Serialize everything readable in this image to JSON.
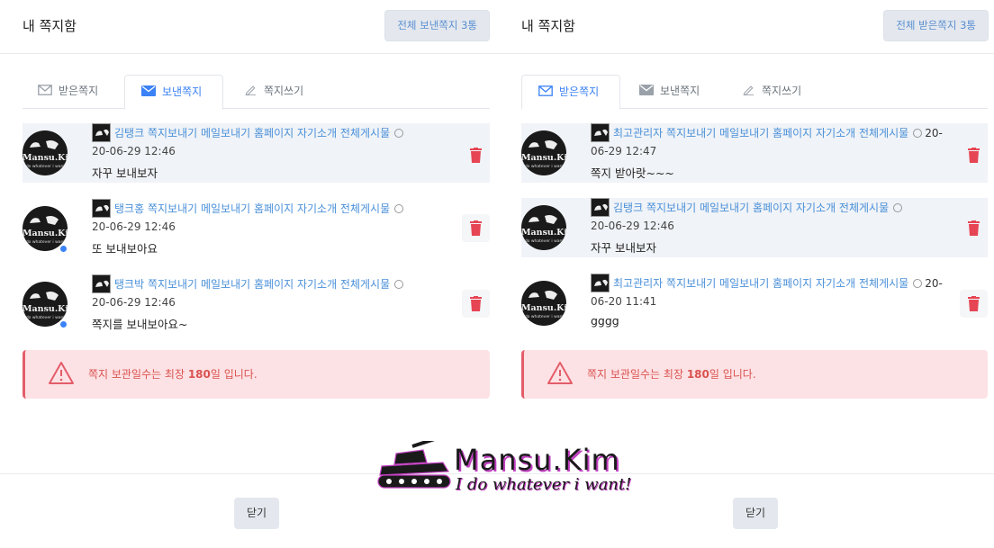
{
  "left": {
    "title": "내 쪽지함",
    "count_button": "전체 보낸쪽지 3통",
    "tabs": [
      {
        "label": "받은쪽지",
        "active": false,
        "icon": "envelope-outline-icon"
      },
      {
        "label": "보낸쪽지",
        "active": true,
        "icon": "envelope-filled-icon"
      },
      {
        "label": "쪽지쓰기",
        "active": false,
        "icon": "pencil-icon"
      }
    ],
    "messages": [
      {
        "name": "김탱크",
        "links": "쪽지보내기 메일보내기 홈페이지 자기소개 전체게시물",
        "date": "20-06-29 12:46",
        "text": "자꾸 보내보자",
        "highlighted": true,
        "unread": false
      },
      {
        "name": "탱크홍",
        "links": "쪽지보내기 메일보내기 홈페이지 자기소개 전체게시물",
        "date": "20-06-29 12:46",
        "text": "또 보내보아요",
        "highlighted": false,
        "unread": true
      },
      {
        "name": "탱크박",
        "links": "쪽지보내기 메일보내기 홈페이지 자기소개 전체게시물",
        "date": "20-06-29 12:46",
        "text": "쪽지를 보내보아요~",
        "highlighted": false,
        "unread": true
      }
    ],
    "alert": {
      "prefix": "쪽지 보관일수는 최장 ",
      "days": "180",
      "suffix": "일 입니다."
    },
    "close_label": "닫기"
  },
  "right": {
    "title": "내 쪽지함",
    "count_button": "전체 받은쪽지 3통",
    "tabs": [
      {
        "label": "받은쪽지",
        "active": true,
        "icon": "envelope-outline-icon"
      },
      {
        "label": "보낸쪽지",
        "active": false,
        "icon": "envelope-filled-icon"
      },
      {
        "label": "쪽지쓰기",
        "active": false,
        "icon": "pencil-icon"
      }
    ],
    "messages": [
      {
        "name": "최고관리자",
        "links": "쪽지보내기 메일보내기 홈페이지 자기소개 전체게시물",
        "date_a": "20-",
        "date_b": "06-29 12:47",
        "text": "쪽지 받아랏~~~",
        "highlighted": true,
        "unread": false
      },
      {
        "name": "김탱크",
        "links": "쪽지보내기 메일보내기 홈페이지 자기소개 전체게시물",
        "date": "20-06-29 12:46",
        "text": "자꾸 보내보자",
        "highlighted": true,
        "unread": false
      },
      {
        "name": "최고관리자",
        "links": "쪽지보내기 메일보내기 홈페이지 자기소개 전체게시물",
        "date_a": "20-",
        "date_b": "06-20 11:41",
        "text": "gggg",
        "highlighted": false,
        "unread": false
      }
    ],
    "alert": {
      "prefix": "쪽지 보관일수는 최장 ",
      "days": "180",
      "suffix": "일 입니다."
    },
    "close_label": "닫기"
  },
  "avatar": {
    "name": "Mansu.Kim",
    "sub": "I do whatever i want!"
  },
  "watermark": {
    "name": "Mansu.Kim",
    "sub": "I do whatever i want!"
  },
  "colors": {
    "accent": "#3b82f6",
    "link": "#4a90d9",
    "danger": "#e35d6a",
    "alert_bg": "#fde2e5",
    "highlight": "#f0f3f7"
  }
}
